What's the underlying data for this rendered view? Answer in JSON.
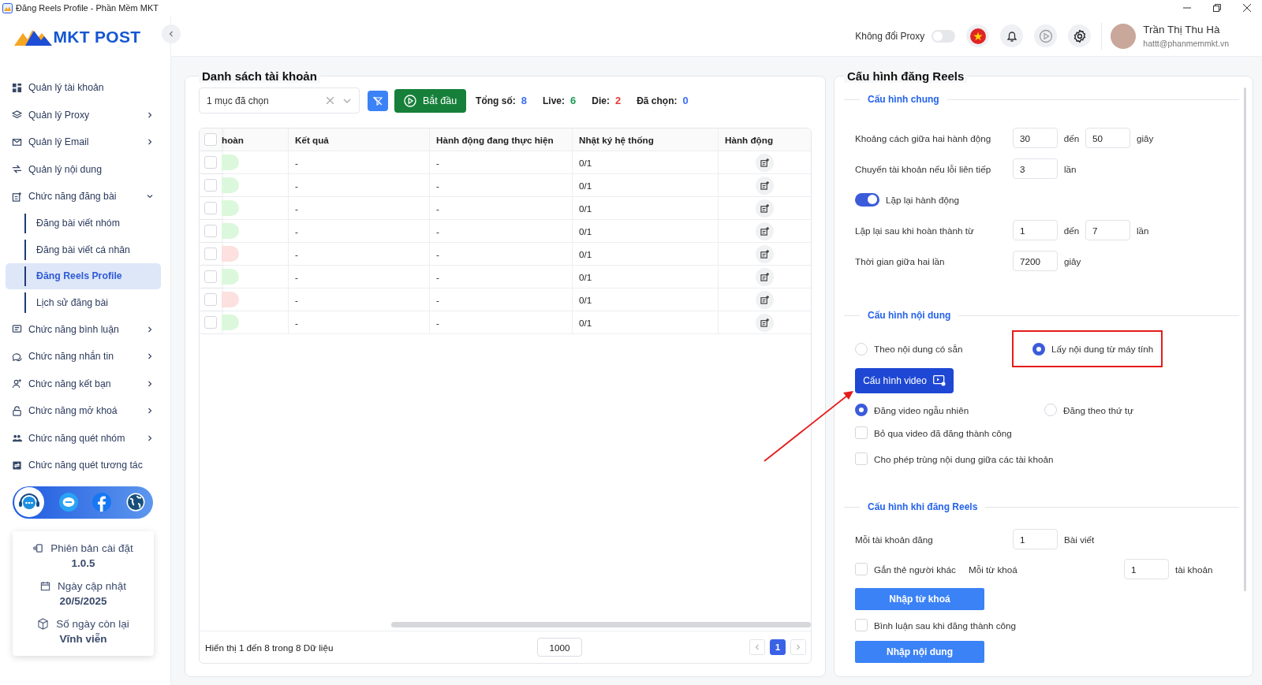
{
  "window": {
    "title": "Đăng Reels Profile - Phần Mềm MKT"
  },
  "logo": {
    "text": "MKT POST"
  },
  "sidebar": {
    "items": [
      {
        "kind": "link",
        "label": "Quản lý tài khoản"
      },
      {
        "kind": "group",
        "label": "Quản lý Proxy",
        "expanded": false
      },
      {
        "kind": "group",
        "label": "Quản lý Email",
        "expanded": false
      },
      {
        "kind": "link",
        "label": "Quản lý nội dung"
      },
      {
        "kind": "group",
        "label": "Chức năng đăng bài",
        "expanded": true,
        "children": [
          {
            "label": "Đăng bài viết nhóm",
            "selected": false
          },
          {
            "label": "Đăng bài viết cá nhân",
            "selected": false
          },
          {
            "label": "Đăng Reels Profile",
            "selected": true
          },
          {
            "label": "Lịch sử đăng bài",
            "selected": false
          }
        ]
      },
      {
        "kind": "group",
        "label": "Chức năng bình luận",
        "expanded": false
      },
      {
        "kind": "group",
        "label": "Chức năng nhắn tin",
        "expanded": false
      },
      {
        "kind": "group",
        "label": "Chức năng kết bạn",
        "expanded": false
      },
      {
        "kind": "group",
        "label": "Chức năng mở khoá",
        "expanded": false
      },
      {
        "kind": "group",
        "label": "Chức năng quét nhóm",
        "expanded": false
      },
      {
        "kind": "link",
        "label": "Chức năng quét tương tác"
      }
    ],
    "info": [
      {
        "label": "Phiên bản cài đặt",
        "value": "1.0.5"
      },
      {
        "label": "Ngày cập nhật",
        "value": "20/5/2025"
      },
      {
        "label": "Số ngày còn lại",
        "value": "Vĩnh viễn"
      }
    ]
  },
  "topbar": {
    "proxy_toggle": {
      "label": "Không đổi Proxy",
      "on": false
    },
    "user": {
      "name": "Trần Thị Thu Hà",
      "email": "hattt@phanmemmkt.vn"
    }
  },
  "accounts": {
    "title": "Danh sách tài khoản",
    "select": {
      "value": "1 mục đã chọn"
    },
    "start_button": "Bắt đầu",
    "stats": [
      {
        "label": "Tổng số:",
        "value": "8",
        "color": "#3b6ff5"
      },
      {
        "label": "Live:",
        "value": "6",
        "color": "#1f9d55"
      },
      {
        "label": "Die:",
        "value": "2",
        "color": "#e53935"
      },
      {
        "label": "Đã chọn:",
        "value": "0",
        "color": "#3b6ff5"
      }
    ],
    "table": {
      "all_checked": false,
      "columns": [
        "hoàn",
        "Kết quả",
        "Hành động đang thực hiện",
        "Nhật ký hệ thống",
        "Hành động"
      ],
      "rows": [
        {
          "checked": false,
          "color": "#dcf8dc",
          "result": "-",
          "current_action": "-",
          "log": "0/1"
        },
        {
          "checked": false,
          "color": "#dcf8dc",
          "result": "-",
          "current_action": "-",
          "log": "0/1"
        },
        {
          "checked": false,
          "color": "#dcf8dc",
          "result": "-",
          "current_action": "-",
          "log": "0/1"
        },
        {
          "checked": false,
          "color": "#dcf8dc",
          "result": "-",
          "current_action": "-",
          "log": "0/1"
        },
        {
          "checked": false,
          "color": "#fde0e0",
          "result": "-",
          "current_action": "-",
          "log": "0/1"
        },
        {
          "checked": false,
          "color": "#dcf8dc",
          "result": "-",
          "current_action": "-",
          "log": "0/1"
        },
        {
          "checked": false,
          "color": "#fde0e0",
          "result": "-",
          "current_action": "-",
          "log": "0/1"
        },
        {
          "checked": false,
          "color": "#dcf8dc",
          "result": "-",
          "current_action": "-",
          "log": "0/1"
        }
      ]
    },
    "footer": {
      "summary": "Hiển thị 1 đến 8 trong 8 Dữ liệu",
      "page_size": "1000",
      "pages": [
        {
          "label": "1",
          "selected": true
        }
      ]
    }
  },
  "config": {
    "title": "Cấu hình đăng Reels",
    "general": {
      "title": "Cấu hình chung",
      "rows": [
        {
          "kind": "range",
          "label": "Khoảng cách giữa hai hành động",
          "from": "30",
          "joiner": "đến",
          "to": "50",
          "unit": "giây"
        },
        {
          "kind": "number",
          "label": "Chuyển tài khoản nếu lỗi liên tiếp",
          "value": "3",
          "unit": "lần"
        },
        {
          "kind": "switch",
          "label": "Lặp lại hành động",
          "on": true
        },
        {
          "kind": "range",
          "label": "Lặp lại sau khi hoàn thành từ",
          "from": "1",
          "joiner": "đến",
          "to": "7",
          "unit": "lần"
        },
        {
          "kind": "number",
          "label": "Thời gian giữa hai lần",
          "value": "7200",
          "unit": "giây"
        }
      ]
    },
    "content": {
      "title": "Cấu hình nội dung",
      "source_options": [
        {
          "label": "Theo nội dung có sẵn",
          "selected": false,
          "highlighted": false
        },
        {
          "label": "Lấy nội dung từ máy tính",
          "selected": true,
          "highlighted": true
        }
      ],
      "video_button": "Cấu hình video",
      "order_options": [
        {
          "label": "Đăng video ngẫu nhiên",
          "selected": true
        },
        {
          "label": "Đăng theo thứ tự",
          "selected": false
        }
      ],
      "options": [
        {
          "label": "Bỏ qua video đã đăng thành công",
          "checked": false
        },
        {
          "label": "Cho phép trùng nội dung giữa các tài khoản",
          "checked": false
        }
      ]
    },
    "reels": {
      "title": "Cấu hình khi đăng Reels",
      "per_account": {
        "label": "Mỗi tài khoản đăng",
        "value": "1",
        "unit": "Bài viết"
      },
      "tag": {
        "label": "Gắn thẻ người khác",
        "checked": false,
        "sub_label": "Mỗi từ khoá",
        "value": "1",
        "unit": "tài khoản"
      },
      "keyword_button": "Nhập từ khoá",
      "comment": {
        "label": "Bình luận sau khi đăng thành công",
        "checked": false
      },
      "content_button": "Nhập nội dung"
    }
  }
}
